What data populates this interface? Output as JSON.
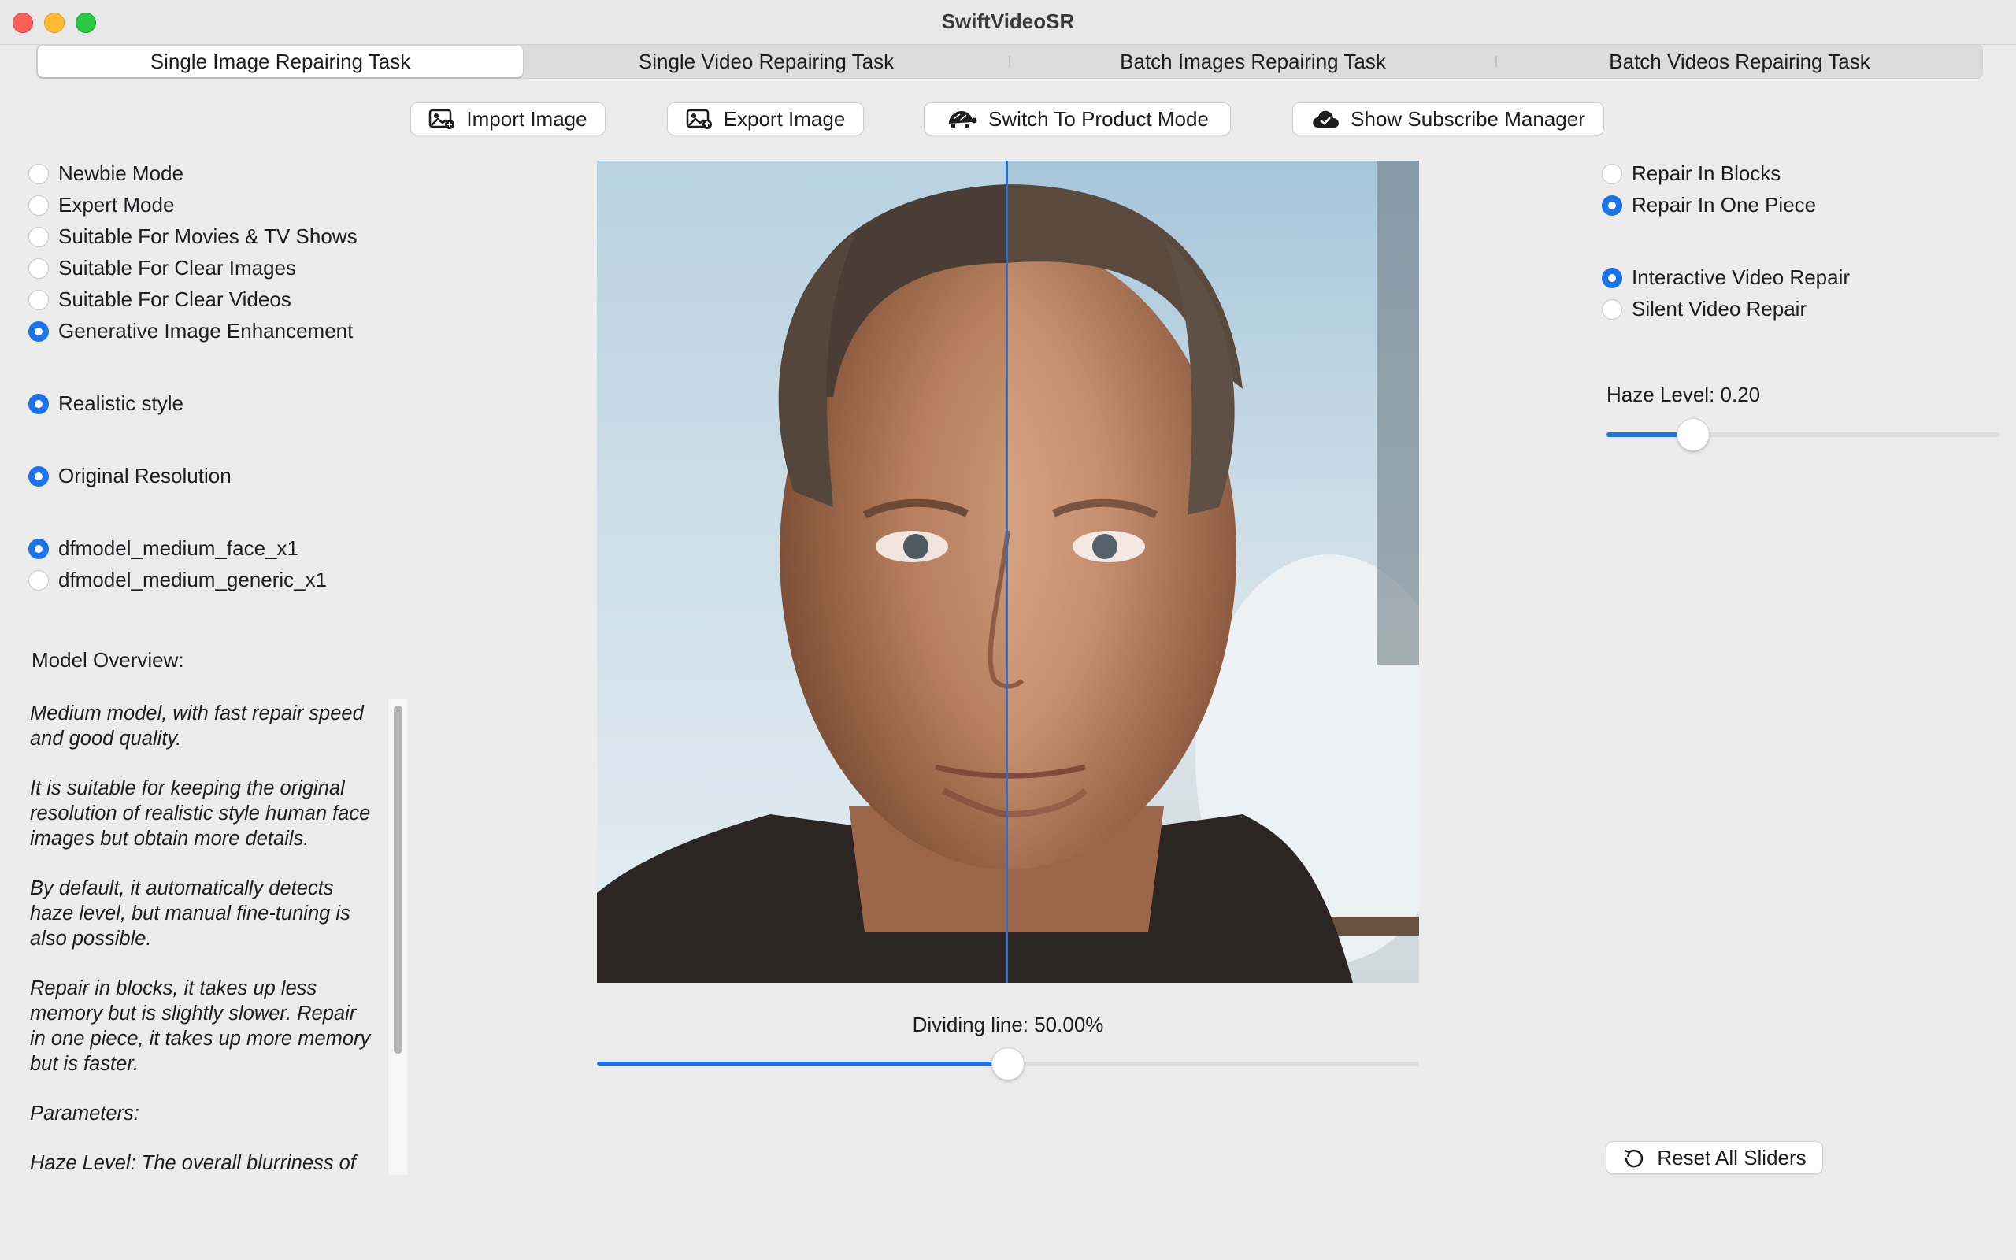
{
  "window": {
    "title": "SwiftVideoSR"
  },
  "tabs": [
    {
      "label": "Single Image Repairing Task",
      "active": true
    },
    {
      "label": "Single Video Repairing Task",
      "active": false
    },
    {
      "label": "Batch Images Repairing Task",
      "active": false
    },
    {
      "label": "Batch Videos Repairing Task",
      "active": false
    }
  ],
  "toolbar": {
    "import_label": "Import Image",
    "export_label": "Export Image",
    "switch_label": "Switch To Product Mode",
    "subscribe_label": "Show Subscribe Manager"
  },
  "modes": [
    {
      "label": "Newbie Mode",
      "selected": false
    },
    {
      "label": "Expert Mode",
      "selected": false
    },
    {
      "label": "Suitable For Movies & TV Shows",
      "selected": false
    },
    {
      "label": "Suitable For Clear Images",
      "selected": false
    },
    {
      "label": "Suitable For Clear Videos",
      "selected": false
    },
    {
      "label": "Generative Image Enhancement",
      "selected": true
    }
  ],
  "style": {
    "label": "Realistic style",
    "selected": true
  },
  "resolution": {
    "label": "Original Resolution",
    "selected": true
  },
  "models": [
    {
      "label": "dfmodel_medium_face_x1",
      "selected": true
    },
    {
      "label": "dfmodel_medium_generic_x1",
      "selected": false
    }
  ],
  "overview": {
    "heading": "Model Overview:",
    "paragraphs": [
      "Medium model, with fast repair speed and good quality.",
      "It is suitable for keeping the original resolution of realistic style human face images but obtain more details.",
      "By default, it automatically detects haze level, but manual fine-tuning is also possible.",
      "Repair in blocks, it takes up less memory but is slightly slower. Repair in one piece, it takes up more memory but is faster.",
      "Parameters:",
      "Haze Level: The overall blurriness of"
    ]
  },
  "repair_method": [
    {
      "label": "Repair In Blocks",
      "selected": false
    },
    {
      "label": "Repair In One Piece",
      "selected": true
    }
  ],
  "video_repair": [
    {
      "label": "Interactive Video Repair",
      "selected": true
    },
    {
      "label": "Silent Video Repair",
      "selected": false
    }
  ],
  "haze": {
    "label": "Haze Level: 0.20",
    "value": 0.2,
    "fraction": 0.22
  },
  "dividing_line": {
    "label": "Dividing line: 50.00%",
    "value": 0.5
  },
  "reset_label": "Reset All Sliders",
  "colors": {
    "accent": "#1a73e8"
  }
}
